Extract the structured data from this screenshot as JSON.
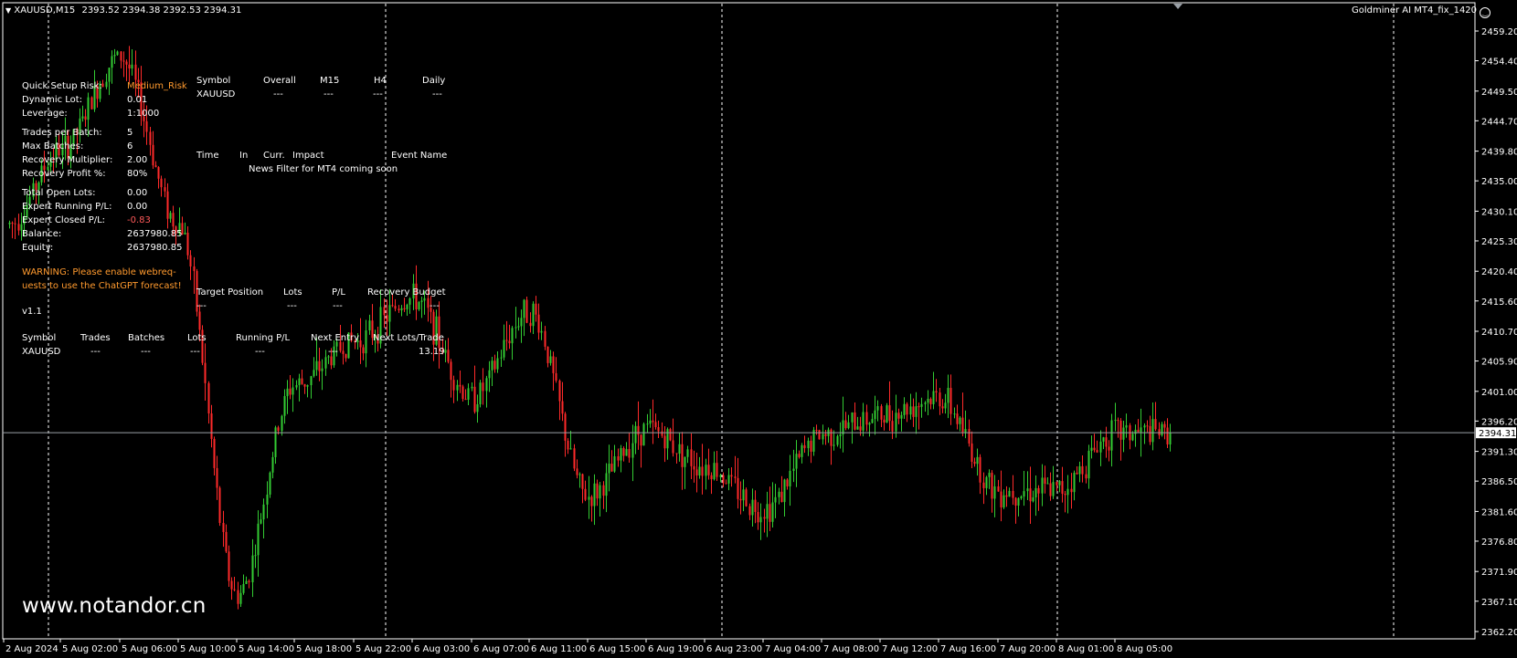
{
  "header": {
    "symbol_tf": "XAUUSD,M15",
    "ohlc": "2393.52 2394.38 2392.53 2394.31",
    "expert": "Goldminer AI MT4_fix_1420",
    "expert_icon": "smiley-icon"
  },
  "settings": {
    "rows": [
      {
        "label": "Quick Setup Risk:",
        "value": "Medium_Risk",
        "value_color": "#ff9a2e"
      },
      {
        "label": "Dynamic Lot:",
        "value": "0.01"
      },
      {
        "label": "Leverage:",
        "value": "1:1000"
      },
      {
        "label": "Trades per Batch:",
        "value": "5"
      },
      {
        "label": "Max Batches:",
        "value": "6"
      },
      {
        "label": "Recovery Multiplier:",
        "value": "2.00"
      },
      {
        "label": "Recovery Profit %:",
        "value": "80%"
      },
      {
        "label": "Total Open Lots:",
        "value": "0.00"
      },
      {
        "label": "Expert Running P/L:",
        "value": "0.00"
      },
      {
        "label": "Expert Closed P/L:",
        "value": "-0.83",
        "value_color": "#ff5a5a"
      },
      {
        "label": "Balance:",
        "value": "2637980.85"
      },
      {
        "label": "Equity:",
        "value": "2637980.85"
      }
    ],
    "warning_line1": "WARNING: Please enable webreq-",
    "warning_line2": "uests to use the ChatGPT forecast!",
    "version": "v1.1"
  },
  "signal_table": {
    "headers": [
      "Symbol",
      "Overall",
      "M15",
      "H4",
      "Daily"
    ],
    "row": [
      "XAUUSD",
      "---",
      "---",
      "---",
      "---"
    ]
  },
  "news_table": {
    "headers": [
      "Time",
      "In",
      "Curr.",
      "Impact",
      "Event Name"
    ],
    "message": "News Filter for MT4 coming soon"
  },
  "target_table": {
    "headers": [
      "Target Position",
      "Lots",
      "P/L",
      "Recovery Budget"
    ],
    "row": [
      "---",
      "---",
      "---",
      "---"
    ]
  },
  "trades_table": {
    "headers": [
      "Symbol",
      "Trades",
      "Batches",
      "Lots",
      "Running P/L",
      "Next Entry",
      "Next Lots/Trade"
    ],
    "row": [
      "XAUUSD",
      "---",
      "---",
      "---",
      "---",
      "---",
      "13.19"
    ]
  },
  "watermark": "www.notandor.cn",
  "colors": {
    "background": "#000000",
    "bull": "#33cc33",
    "bear": "#ff2a2a",
    "grid": "#ffffff",
    "text": "#ffffff",
    "accent": "#ff9a2e"
  },
  "chart_data": {
    "type": "candlestick",
    "symbol": "XAUUSD",
    "timeframe": "M15",
    "ylim": [
      2360.0,
      2462.0
    ],
    "y_ticks": [
      "2459.20",
      "2454.40",
      "2449.50",
      "2444.70",
      "2439.80",
      "2435.00",
      "2430.10",
      "2425.30",
      "2420.40",
      "2415.60",
      "2410.70",
      "2405.90",
      "2401.00",
      "2396.20",
      "2391.30",
      "2386.50",
      "2381.60",
      "2376.80",
      "2371.90",
      "2367.10",
      "2362.20"
    ],
    "y_tick_values": [
      2459.2,
      2454.4,
      2449.5,
      2444.7,
      2439.8,
      2435.0,
      2430.1,
      2425.3,
      2420.4,
      2415.6,
      2410.7,
      2405.9,
      2401.0,
      2396.2,
      2391.3,
      2386.5,
      2381.6,
      2376.8,
      2371.9,
      2367.1,
      2362.2
    ],
    "current_price": "2394.31",
    "current_price_value": 2394.31,
    "x_ticks": [
      "2 Aug 2024",
      "5 Aug 02:00",
      "5 Aug 06:00",
      "5 Aug 10:00",
      "5 Aug 14:00",
      "5 Aug 18:00",
      "5 Aug 22:00",
      "6 Aug 03:00",
      "6 Aug 07:00",
      "6 Aug 11:00",
      "6 Aug 15:00",
      "6 Aug 19:00",
      "6 Aug 23:00",
      "7 Aug 04:00",
      "7 Aug 08:00",
      "7 Aug 12:00",
      "7 Aug 16:00",
      "7 Aug 20:00",
      "8 Aug 01:00",
      "8 Aug 05:00"
    ],
    "day_separators": [
      "5 Aug 00:00",
      "6 Aug 00:00",
      "7 Aug 00:00",
      "8 Aug 00:00",
      "9 Aug 00:00"
    ],
    "price_path": [
      {
        "t": "2 Aug 2024",
        "price": 2428
      },
      {
        "t": "5 Aug 02:00",
        "price": 2440
      },
      {
        "t": "5 Aug 06:00",
        "price": 2455
      },
      {
        "t": "5 Aug 10:00",
        "price": 2428
      },
      {
        "t": "5 Aug 14:00",
        "price": 2368
      },
      {
        "t": "5 Aug 18:00",
        "price": 2402
      },
      {
        "t": "5 Aug 22:00",
        "price": 2409
      },
      {
        "t": "6 Aug 03:00",
        "price": 2416
      },
      {
        "t": "6 Aug 07:00",
        "price": 2400
      },
      {
        "t": "6 Aug 11:00",
        "price": 2414
      },
      {
        "t": "6 Aug 15:00",
        "price": 2384
      },
      {
        "t": "6 Aug 19:00",
        "price": 2395
      },
      {
        "t": "6 Aug 23:00",
        "price": 2389
      },
      {
        "t": "7 Aug 04:00",
        "price": 2382
      },
      {
        "t": "7 Aug 08:00",
        "price": 2394
      },
      {
        "t": "7 Aug 12:00",
        "price": 2397
      },
      {
        "t": "7 Aug 16:00",
        "price": 2400
      },
      {
        "t": "7 Aug 20:00",
        "price": 2385
      },
      {
        "t": "8 Aug 01:00",
        "price": 2385
      },
      {
        "t": "8 Aug 05:00",
        "price": 2394.31
      }
    ]
  }
}
